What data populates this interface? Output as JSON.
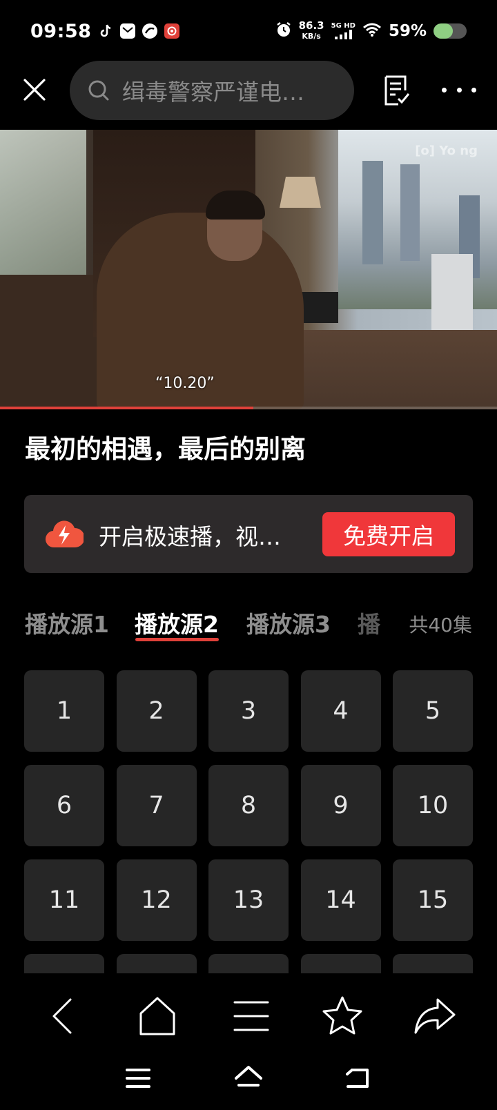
{
  "status_bar": {
    "time": "09:58",
    "net_speed_value": "86.3",
    "net_speed_unit": "KB/s",
    "signal_label": "5G HD",
    "battery_percent": "59%",
    "battery_level": 0.59
  },
  "search": {
    "query": "缉毒警察严谨电…"
  },
  "video": {
    "watermark": "[o] Yo ng",
    "subtitle": "“10.20”",
    "progress": 0.51
  },
  "title": "最初的相遇，最后的别离",
  "banner": {
    "text": "开启极速播，视…",
    "button_label": "免费开启"
  },
  "tabs": [
    {
      "label": "播放源1"
    },
    {
      "label": "播放源2"
    },
    {
      "label": "播放源3"
    },
    {
      "label": "播"
    }
  ],
  "active_tab": 1,
  "total_episodes": "共40集",
  "episodes": [
    "1",
    "2",
    "3",
    "4",
    "5",
    "6",
    "7",
    "8",
    "9",
    "10",
    "11",
    "12",
    "13",
    "14",
    "15",
    "",
    "",
    "",
    "",
    ""
  ],
  "colors": {
    "accent": "#e0413a",
    "button": "#f0373a",
    "tile": "#262626",
    "banner_bg": "#2d2a2b"
  }
}
